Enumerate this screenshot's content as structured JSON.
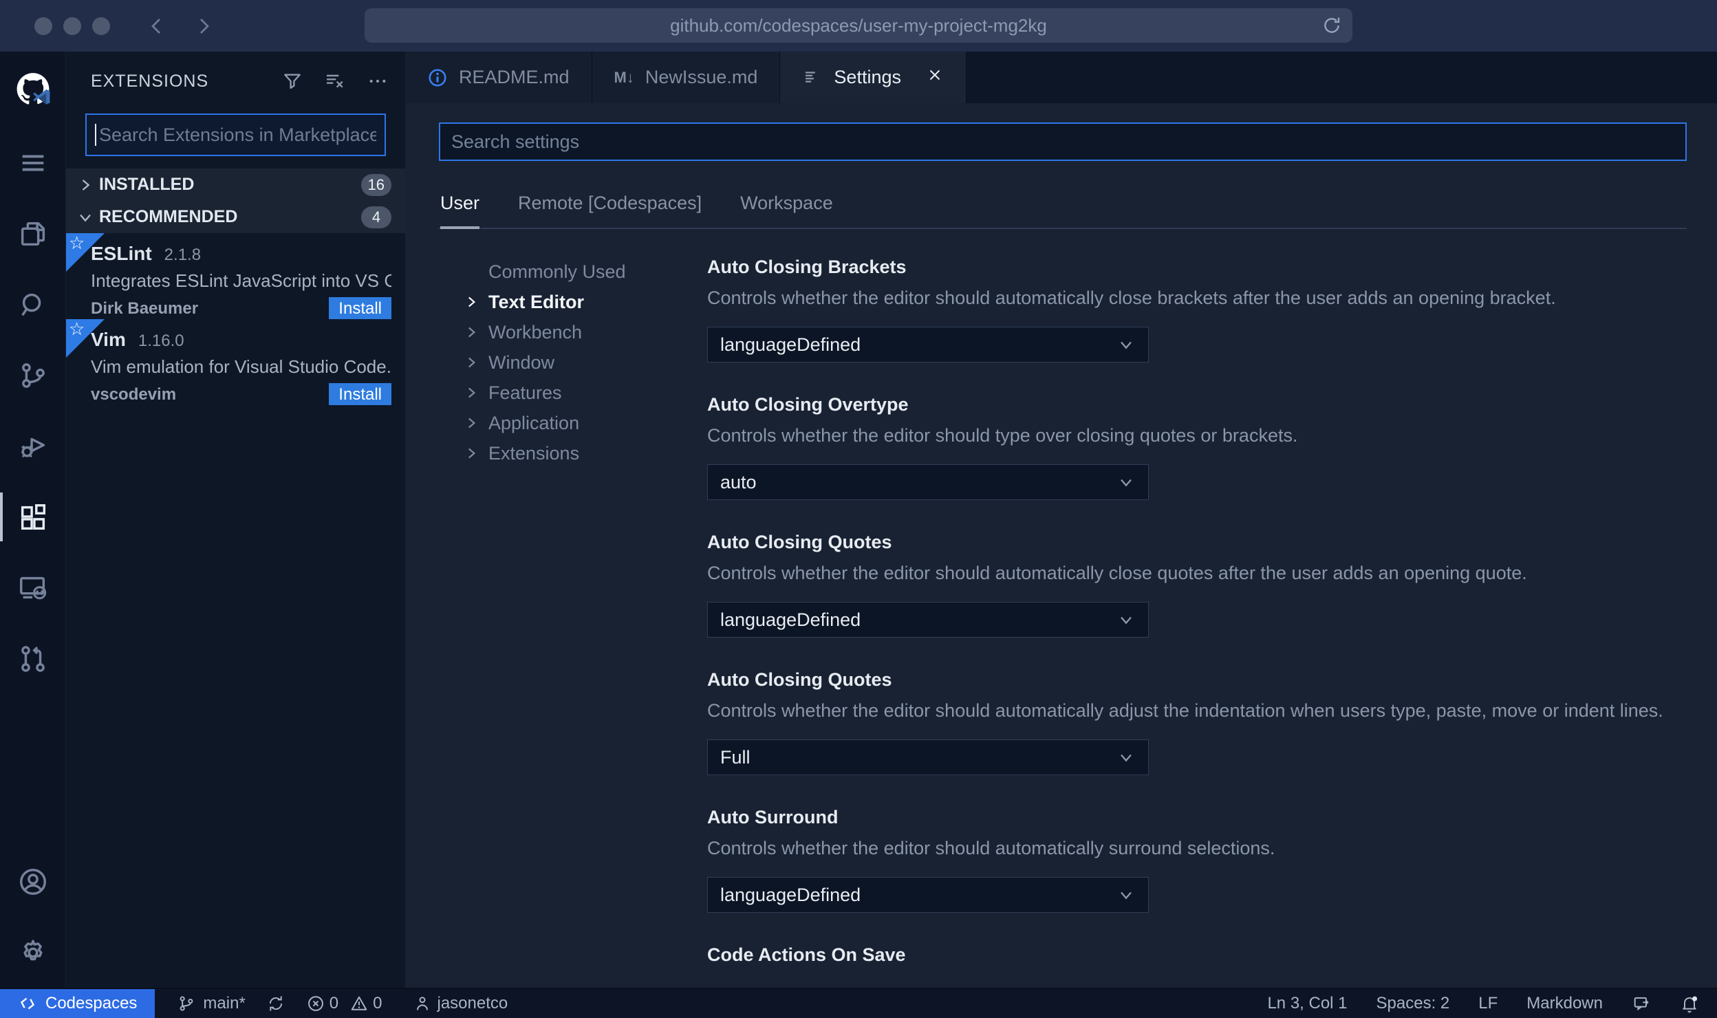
{
  "colors": {
    "accent_blue": "#2e75e8",
    "install_blue": "#2e7ce0",
    "codespaces_blue": "#2c6be4",
    "editor_bg": "#192232",
    "sidebar_bg": "#0e1726",
    "chrome_bg": "#212d49"
  },
  "browser": {
    "url": "github.com/codespaces/user-my-project-mg2kg",
    "icons": [
      "back-icon",
      "forward-icon",
      "reload-icon"
    ]
  },
  "activity_bar": {
    "icons": [
      "github-codespaces-logo",
      "menu-icon",
      "explorer-icon",
      "search-icon",
      "source-control-icon",
      "run-debug-icon",
      "extensions-icon",
      "remote-explorer-icon",
      "pull-requests-icon",
      "account-icon",
      "settings-gear-icon"
    ],
    "active": "extensions"
  },
  "sidebar": {
    "title": "EXTENSIONS",
    "action_icons": [
      "filter-icon",
      "clear-extensions-search-icon",
      "more-actions-icon"
    ],
    "search_placeholder": "Search Extensions in Marketplace",
    "sections": [
      {
        "label": "INSTALLED",
        "count": "16",
        "state": "collapsed"
      },
      {
        "label": "RECOMMENDED",
        "count": "4",
        "state": "expanded"
      }
    ],
    "extensions": [
      {
        "name": "ESLint",
        "version": "2.1.8",
        "description": "Integrates ESLint JavaScript into VS C...",
        "publisher": "Dirk Baeumer",
        "action": "Install"
      },
      {
        "name": "Vim",
        "version": "1.16.0",
        "description": "Vim emulation for Visual Studio Code...",
        "publisher": "vscodevim",
        "action": "Install"
      }
    ]
  },
  "tabs": [
    {
      "label": "README.md",
      "icon": "info-icon"
    },
    {
      "label": "NewIssue.md",
      "icon": "markdown-icon",
      "icon_glyph": "M↓"
    },
    {
      "label": "Settings",
      "icon": "settings-list-icon",
      "active": true,
      "close_icon": "close-icon"
    }
  ],
  "settings": {
    "search_placeholder": "Search settings",
    "scopes": [
      {
        "label": "User",
        "active": true
      },
      {
        "label": "Remote [Codespaces]",
        "active": false
      },
      {
        "label": "Workspace",
        "active": false
      }
    ],
    "toc": [
      {
        "label": "Commonly Used",
        "chevron": false,
        "active": false
      },
      {
        "label": "Text Editor",
        "chevron": true,
        "active": true
      },
      {
        "label": "Workbench",
        "chevron": true,
        "active": false
      },
      {
        "label": "Window",
        "chevron": true,
        "active": false
      },
      {
        "label": "Features",
        "chevron": true,
        "active": false
      },
      {
        "label": "Application",
        "chevron": true,
        "active": false
      },
      {
        "label": "Extensions",
        "chevron": true,
        "active": false
      }
    ],
    "items": [
      {
        "title": "Auto Closing Brackets",
        "description": "Controls whether the editor should automatically close brackets after the user adds an opening bracket.",
        "value": "languageDefined"
      },
      {
        "title": "Auto Closing Overtype",
        "description": "Controls whether the editor should type over closing quotes or brackets.",
        "value": "auto"
      },
      {
        "title": "Auto Closing Quotes",
        "description": "Controls whether the editor should automatically close quotes after the user adds an opening quote.",
        "value": "languageDefined"
      },
      {
        "title": "Auto Closing Quotes",
        "description": "Controls whether the editor should automatically adjust the indentation when users type, paste, move or indent lines.",
        "value": "Full"
      },
      {
        "title": "Auto Surround",
        "description": "Controls whether the editor should automatically surround selections.",
        "value": "languageDefined"
      },
      {
        "title": "Code Actions On Save"
      }
    ]
  },
  "status_bar": {
    "codespaces": "Codespaces",
    "branch": "main*",
    "errors": "0",
    "warnings": "0",
    "user": "jasonetco",
    "line_col": "Ln 3, Col 1",
    "spaces": "Spaces: 2",
    "eol": "LF",
    "language": "Markdown",
    "icons": [
      "remote-icon",
      "branch-icon",
      "sync-icon",
      "error-icon",
      "warning-icon",
      "person-icon",
      "feedback-icon",
      "bell-icon"
    ]
  }
}
